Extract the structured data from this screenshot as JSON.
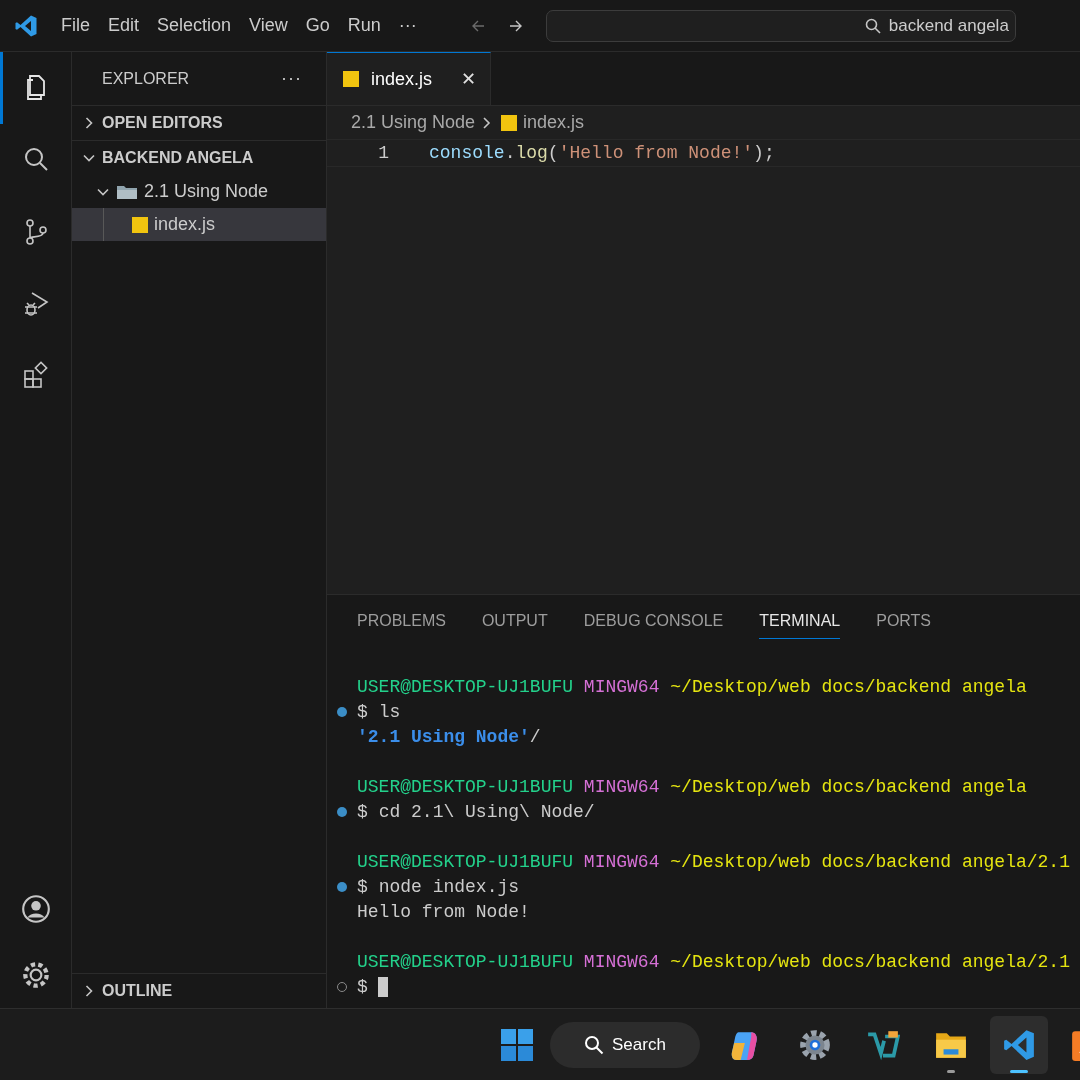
{
  "menu": [
    "File",
    "Edit",
    "Selection",
    "View",
    "Go",
    "Run",
    "···"
  ],
  "nav": [
    {
      "kind": "back",
      "disabled": true
    },
    {
      "kind": "forward",
      "disabled": false
    }
  ],
  "command_center": {
    "value": "backend angela"
  },
  "activity_bar": [
    {
      "kind": "explorer",
      "selected": true
    },
    {
      "kind": "search",
      "selected": false
    },
    {
      "kind": "source-control",
      "selected": false
    },
    {
      "kind": "run-debug",
      "selected": false
    },
    {
      "kind": "extensions",
      "selected": false
    }
  ],
  "activity_bar_bottom": [
    {
      "kind": "account"
    },
    {
      "kind": "settings"
    }
  ],
  "sidebar": {
    "title": "EXPLORER",
    "more": "···",
    "sections": [
      {
        "label": "OPEN EDITORS",
        "expanded": false
      },
      {
        "label": "BACKEND ANGELA",
        "expanded": true,
        "children": [
          {
            "label": "2.1 Using Node",
            "kind": "folder",
            "expanded": true,
            "selected": false,
            "children": [
              {
                "label": "index.js",
                "kind": "js",
                "selected": true
              }
            ]
          }
        ]
      }
    ],
    "bottom_sections": [
      {
        "label": "OUTLINE",
        "expanded": false
      }
    ]
  },
  "tabs": [
    {
      "label": "index.js",
      "kind": "js",
      "selected": true,
      "close": "✕"
    }
  ],
  "breadcrumb": [
    {
      "label": "2.1 Using Node",
      "kind": "folder"
    },
    {
      "label": "index.js",
      "kind": "js"
    }
  ],
  "code": [
    {
      "number": "1",
      "tokens": [
        {
          "text": "console",
          "kind": "variable"
        },
        {
          "text": ".",
          "kind": "plain"
        },
        {
          "text": "log",
          "kind": "function"
        },
        {
          "text": "(",
          "kind": "plain"
        },
        {
          "text": "'Hello from Node!'",
          "kind": "string"
        },
        {
          "text": ");",
          "kind": "plain"
        }
      ]
    }
  ],
  "panel_tabs": [
    {
      "label": "PROBLEMS",
      "selected": false
    },
    {
      "label": "OUTPUT",
      "selected": false
    },
    {
      "label": "DEBUG CONSOLE",
      "selected": false
    },
    {
      "label": "TERMINAL",
      "selected": true
    },
    {
      "label": "PORTS",
      "selected": false
    }
  ],
  "terminal": [
    {
      "kind": "prompt",
      "user": "USER@DESKTOP-UJ1BUFU",
      "system": "MINGW64",
      "path": "~/Desktop/web docs/backend angela"
    },
    {
      "kind": "command",
      "completed": true,
      "symbol": "$",
      "text": "ls"
    },
    {
      "kind": "listing",
      "name": "'2.1 Using Node'",
      "suffix": "/"
    },
    {
      "kind": "blank"
    },
    {
      "kind": "prompt",
      "user": "USER@DESKTOP-UJ1BUFU",
      "system": "MINGW64",
      "path": "~/Desktop/web docs/backend angela"
    },
    {
      "kind": "command",
      "completed": true,
      "symbol": "$",
      "text": "cd 2.1\\ Using\\ Node/"
    },
    {
      "kind": "blank"
    },
    {
      "kind": "prompt",
      "user": "USER@DESKTOP-UJ1BUFU",
      "system": "MINGW64",
      "path": "~/Desktop/web docs/backend angela/2.1"
    },
    {
      "kind": "command",
      "completed": true,
      "symbol": "$",
      "text": "node index.js"
    },
    {
      "kind": "output",
      "text": "Hello from Node!"
    },
    {
      "kind": "blank"
    },
    {
      "kind": "prompt",
      "user": "USER@DESKTOP-UJ1BUFU",
      "system": "MINGW64",
      "path": "~/Desktop/web docs/backend angela/2.1"
    },
    {
      "kind": "command",
      "completed": false,
      "symbol": "$",
      "cursor": true
    }
  ],
  "taskbar": {
    "search_label": "Search",
    "apps": [
      {
        "kind": "copilot",
        "running": false,
        "active": false
      },
      {
        "kind": "settings",
        "running": false,
        "active": false
      },
      {
        "kind": "editor-app",
        "running": false,
        "active": false
      },
      {
        "kind": "files",
        "running": true,
        "active": false
      },
      {
        "kind": "vscode",
        "running": true,
        "active": true
      },
      {
        "kind": "xampp",
        "running": false,
        "active": false
      }
    ]
  }
}
